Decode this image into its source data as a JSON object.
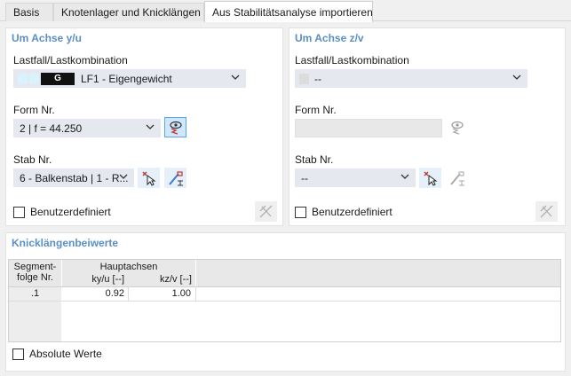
{
  "tabs": [
    {
      "label": "Basis"
    },
    {
      "label": "Knotenlager und Knicklängen"
    },
    {
      "label": "Aus Stabilitätsanalyse importieren"
    }
  ],
  "left": {
    "title": "Um Achse y/u",
    "loadcase_label": "Lastfall/Lastkombination",
    "loadcase_badge": "G",
    "loadcase_value": "LF1 - Eigengewicht",
    "form_label": "Form Nr.",
    "form_value": "2 | f = 44.250",
    "stab_label": "Stab Nr.",
    "stab_value": "6 - Balkenstab | 1 - R...",
    "userdef_label": "Benutzerdefiniert"
  },
  "right": {
    "title": "Um Achse z/v",
    "loadcase_label": "Lastfall/Lastkombination",
    "loadcase_value": "--",
    "form_label": "Form Nr.",
    "stab_label": "Stab Nr.",
    "stab_value": "--",
    "userdef_label": "Benutzerdefiniert"
  },
  "knick": {
    "title": "Knicklängenbeiwerte",
    "headers": {
      "segment_line1": "Segment-",
      "segment_line2": "folge Nr.",
      "hauptachsen": "Hauptachsen",
      "ky": "ky/u [--]",
      "kz": "kz/v [--]"
    },
    "rows": [
      {
        "seg": ".1",
        "ky": "0.92",
        "kz": "1.00"
      }
    ],
    "absolute_label": "Absolute Werte"
  },
  "colors": {
    "title_blue": "#5b8fc3",
    "combo_bg": "#e6e8f0",
    "swatch_cyan": "#d8f3fb",
    "button_blue": "#cfe6fb"
  }
}
